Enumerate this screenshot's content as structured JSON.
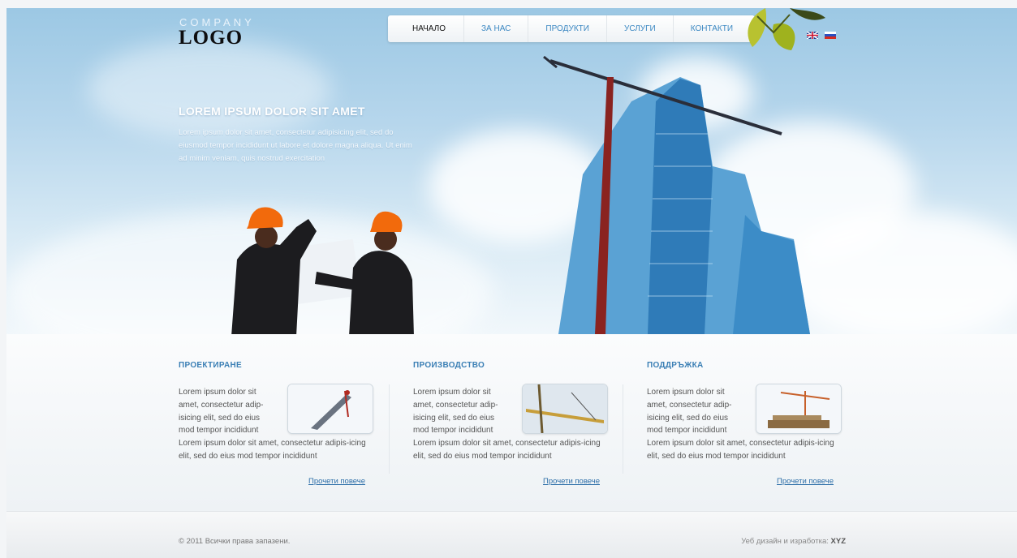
{
  "logo": {
    "company": "COMPANY",
    "logo": "LOGO"
  },
  "nav": {
    "items": [
      "НАЧАЛО",
      "ЗА НАС",
      "ПРОДУКТИ",
      "УСЛУГИ",
      "КОНТАКТИ"
    ],
    "active_index": 0
  },
  "languages": [
    "english-flag-icon",
    "russian-flag-icon"
  ],
  "hero": {
    "title": "LOREM IPSUM DOLOR SIT AMET",
    "text": "Lorem ipsum dolor sit amet, consectetur adipisicing elit, sed do eiusmod tempor incididunt ut labore et dolore magna aliqua. Ut enim ad minim veniam, quis nostrud exercitation"
  },
  "columns": [
    {
      "title": "ПРОЕКТИРАНЕ",
      "short": "Lorem ipsum dolor sit amet, consectetur adip-isicing elit, sed do eius mod tempor incididunt",
      "long": "Lorem ipsum dolor sit amet, consectetur adipis-icing elit, sed do eius mod tempor incididunt",
      "more": "Прочети повече",
      "image": "crane-icon"
    },
    {
      "title": "ПРОИЗВОДСТВО",
      "short": "Lorem ipsum dolor sit amet, consectetur adip-isicing elit, sed do eius mod tempor incididunt",
      "long": "Lorem ipsum dolor sit amet, consectetur adipis-icing elit, sed do eius mod tempor incididunt",
      "more": "Прочети повече",
      "image": "crane-boom-icon"
    },
    {
      "title": "ПОДДРЪЖКА",
      "short": "Lorem ipsum dolor sit amet, consectetur adip-isicing elit, sed do eius mod tempor incididunt",
      "long": "Lorem ipsum dolor sit amet, consectetur adipis-icing elit, sed do eius mod tempor incididunt",
      "more": "Прочети повече",
      "image": "construction-site-icon"
    }
  ],
  "footer": {
    "copyright": "© 2011 Всички права запазени.",
    "credit_label": "Уеб дизайн и изработка:",
    "credit_name": "XYZ"
  },
  "colors": {
    "accent": "#3b7fb5",
    "sky": "#b6d6ec"
  }
}
